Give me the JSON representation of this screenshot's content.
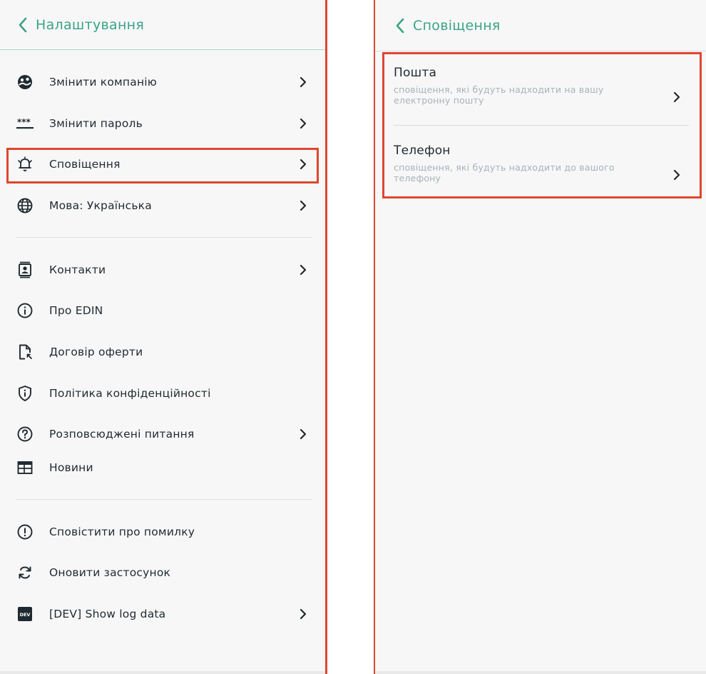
{
  "settings": {
    "title": "Налаштування",
    "items": [
      {
        "label": "Змінити компанію",
        "icon": "company-switch-icon"
      },
      {
        "label": "Змінити пароль",
        "icon": "password-icon"
      },
      {
        "label": "Сповіщення",
        "icon": "bell-icon"
      },
      {
        "label": "Мова: Українська",
        "icon": "globe-icon"
      },
      {
        "label": "Контакти",
        "icon": "contacts-icon"
      },
      {
        "label": "Про EDIN",
        "icon": "info-icon"
      },
      {
        "label": "Договір оферти",
        "icon": "document-icon"
      },
      {
        "label": "Політика конфіденційності",
        "icon": "shield-info-icon"
      },
      {
        "label": "Розповсюджені питання",
        "icon": "question-icon"
      },
      {
        "label": "Новини",
        "icon": "news-icon"
      },
      {
        "label": "Сповістити про помилку",
        "icon": "alert-icon"
      },
      {
        "label": "Оновити застосунок",
        "icon": "refresh-icon"
      },
      {
        "label": "[DEV] Show log data",
        "icon": "dev-badge-icon",
        "badge": "DEV"
      }
    ]
  },
  "notifications": {
    "title": "Сповіщення",
    "items": [
      {
        "title": "Пошта",
        "description": "сповіщення, які будуть надходити на вашу електронну пошту"
      },
      {
        "title": "Телефон",
        "description": "сповіщення, які будуть надходити до вашого телефону"
      }
    ]
  },
  "colors": {
    "accent": "#3aa387",
    "highlight": "#e0462f",
    "text": "#1f2a30",
    "muted": "#a7b3ba"
  }
}
